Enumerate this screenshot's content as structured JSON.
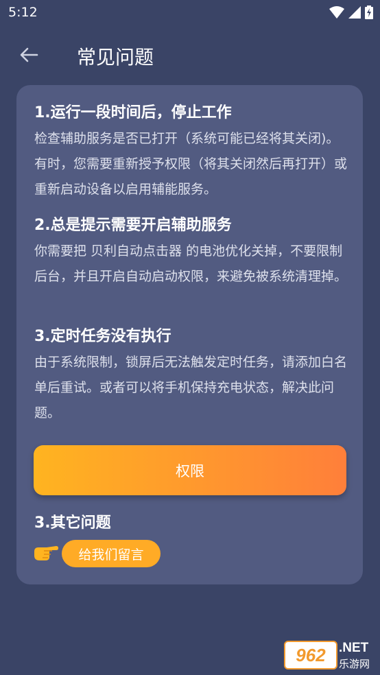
{
  "status_bar": {
    "time": "5:12",
    "icons": [
      "wifi-icon",
      "signal-icon",
      "battery-charging-icon"
    ]
  },
  "app_bar": {
    "back_icon": "arrow-left-icon",
    "title": "常见问题"
  },
  "faq": [
    {
      "title": "1.运行一段时间后，停止工作",
      "body": "检查辅助服务是否已打开（系统可能已经将其关闭)。有时，您需要重新授予权限（将其关闭然后再打开）或重新启动设备以启用辅能服务。"
    },
    {
      "title": "2.总是提示需要开启辅助服务",
      "body": "你需要把 贝利自动点击器 的电池优化关掉，不要限制后台，并且开启自动启动权限，来避免被系统清理掉。"
    },
    {
      "title": "3.定时任务没有执行",
      "body": "由于系统限制，锁屏后无法触发定时任务，请添加白名单后重试。或者可以将手机保持充电状态，解决此问题。"
    }
  ],
  "permission_button": {
    "label": "权限",
    "gradient": [
      "#ffb420",
      "#ff7f3a"
    ]
  },
  "other": {
    "title": "3.其它问题",
    "hand_icon": "pointing-hand-icon",
    "feedback_label": "给我们留言"
  },
  "watermark": {
    "logo": "962",
    "net": ".NET",
    "sub": "乐游网"
  },
  "colors": {
    "background": "#3a4466",
    "card": "#525b81",
    "accent": "#ffab26"
  }
}
